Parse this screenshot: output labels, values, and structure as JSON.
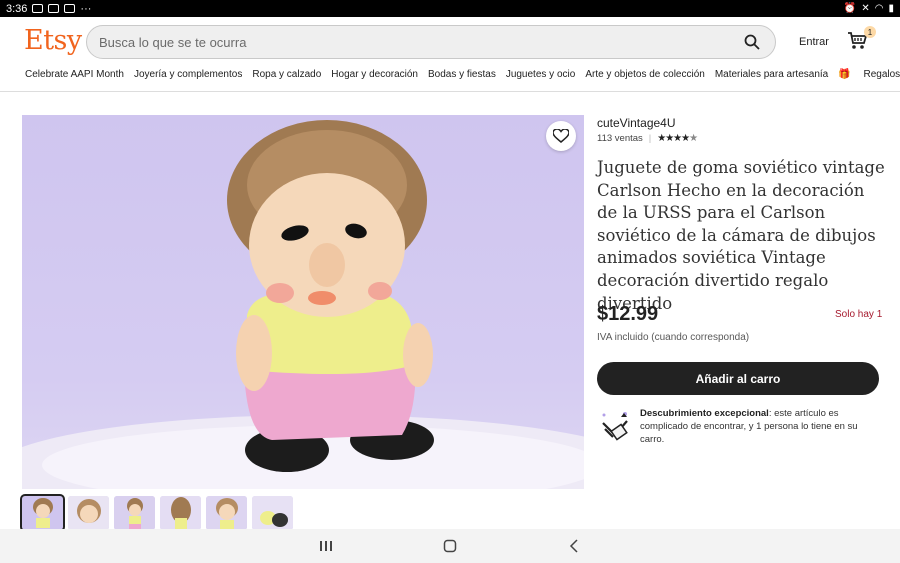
{
  "status_bar": {
    "time": "3:36",
    "more": "···"
  },
  "header": {
    "logo": "Etsy",
    "search": {
      "placeholder": "Busca lo que se te ocurra"
    },
    "signin": "Entrar",
    "cart_count": "1"
  },
  "nav": {
    "items": [
      "Celebrate AAPI Month",
      "Joyería y complementos",
      "Ropa y calzado",
      "Hogar y decoración",
      "Bodas y fiestas",
      "Juguetes y ocio",
      "Arte y objetos de colección",
      "Materiales para artesanía",
      "Regalos"
    ]
  },
  "listing": {
    "seller": "cuteVintage4U",
    "sales": "113 ventas",
    "rating": 4.5,
    "title": "Juguete de goma soviético vintage Carlson Hecho en la decoración de la URSS para el Carlson soviético de la cámara de dibujos animados soviética Vintage decoración divertido regalo divertido",
    "price": "$12.99",
    "stock": "Solo hay 1",
    "tax": "IVA incluido (cuando corresponda)",
    "add_to_cart": "Añadir al carro",
    "discovery_bold": "Descubrimiento excepcional",
    "discovery_rest": ": este artículo es complicado de encontrar, y 1 persona lo tiene en su carro."
  },
  "colors": {
    "brand": "#F1641E",
    "stock": "#a61a2e",
    "button": "#222222"
  }
}
